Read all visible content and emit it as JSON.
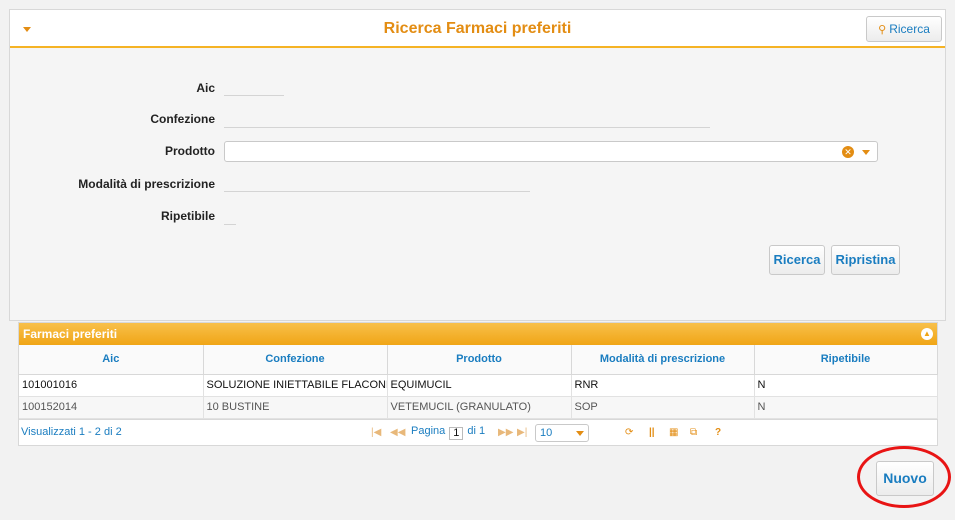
{
  "search_panel": {
    "title": "Ricerca Farmaci preferiti",
    "header_search_label": "Ricerca",
    "fields": {
      "aic_label": "Aic",
      "confezione_label": "Confezione",
      "prodotto_label": "Prodotto",
      "modalita_label": "Modalità di prescrizione",
      "ripetibile_label": "Ripetibile",
      "prodotto_value": ""
    },
    "search_button_label": "Ricerca",
    "reset_button_label": "Ripristina"
  },
  "grid": {
    "caption": "Farmaci preferiti",
    "columns": [
      "Aic",
      "Confezione",
      "Prodotto",
      "Modalità di prescrizione",
      "Ripetibile"
    ],
    "rows": [
      {
        "aic": "101001016",
        "confezione": "SOLUZIONE INIETTABILE FLACONE DA",
        "prodotto": "EQUIMUCIL",
        "modalita": "RNR",
        "ripetibile": "N"
      },
      {
        "aic": "100152014",
        "confezione": "10 BUSTINE",
        "prodotto": "VETEMUCIL (GRANULATO)",
        "modalita": "SOP",
        "ripetibile": "N"
      }
    ],
    "pager": {
      "info": "Visualizzati 1 - 2 di 2",
      "page_label": "Pagina",
      "page_value": "1",
      "of_label": "di 1",
      "rows_per_page": "10"
    }
  },
  "new_button_label": "Nuovo",
  "colors": {
    "accent_orange": "#e38d13",
    "link_blue": "#1a7dc0",
    "highlight_red": "#e81414"
  }
}
